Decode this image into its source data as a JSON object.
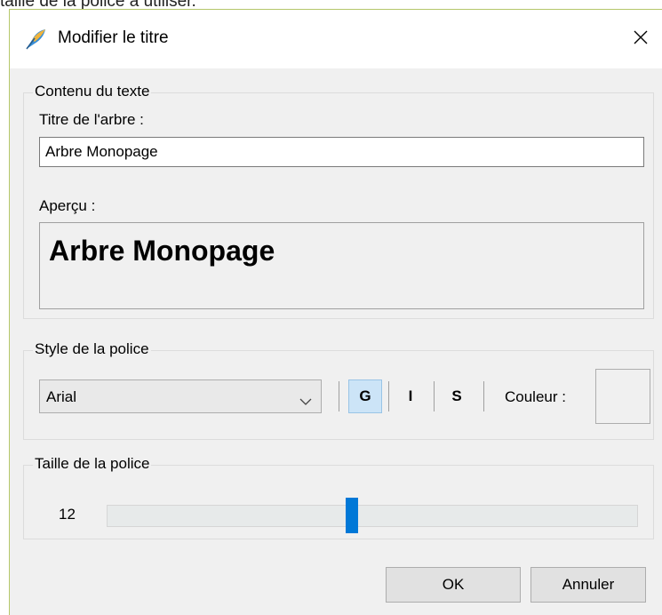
{
  "background_caption": "taille de la police à utiliser.",
  "dialog": {
    "title": "Modifier le titre",
    "close_icon": "close-icon",
    "app_icon": "feather-pen-icon"
  },
  "content_group": {
    "legend": "Contenu du texte",
    "title_label": "Titre de l'arbre :",
    "title_value": "Arbre Monopage",
    "preview_label": "Aperçu :",
    "preview_text": "Arbre Monopage"
  },
  "font_style_group": {
    "legend": "Style de la police",
    "font_select": {
      "selected": "Arial"
    },
    "bold_label": "G",
    "italic_label": "I",
    "underline_label": "S",
    "bold_active": true,
    "color_label": "Couleur :",
    "color_value": "#f0f0f0"
  },
  "font_size_group": {
    "legend": "Taille de la police",
    "size_value": "12",
    "slider_fraction": 0.46
  },
  "buttons": {
    "ok": "OK",
    "cancel": "Annuler"
  },
  "colors": {
    "accent": "#0078d7",
    "active_button": "#cce4f7",
    "dialog_background": "#f0f0f0"
  }
}
